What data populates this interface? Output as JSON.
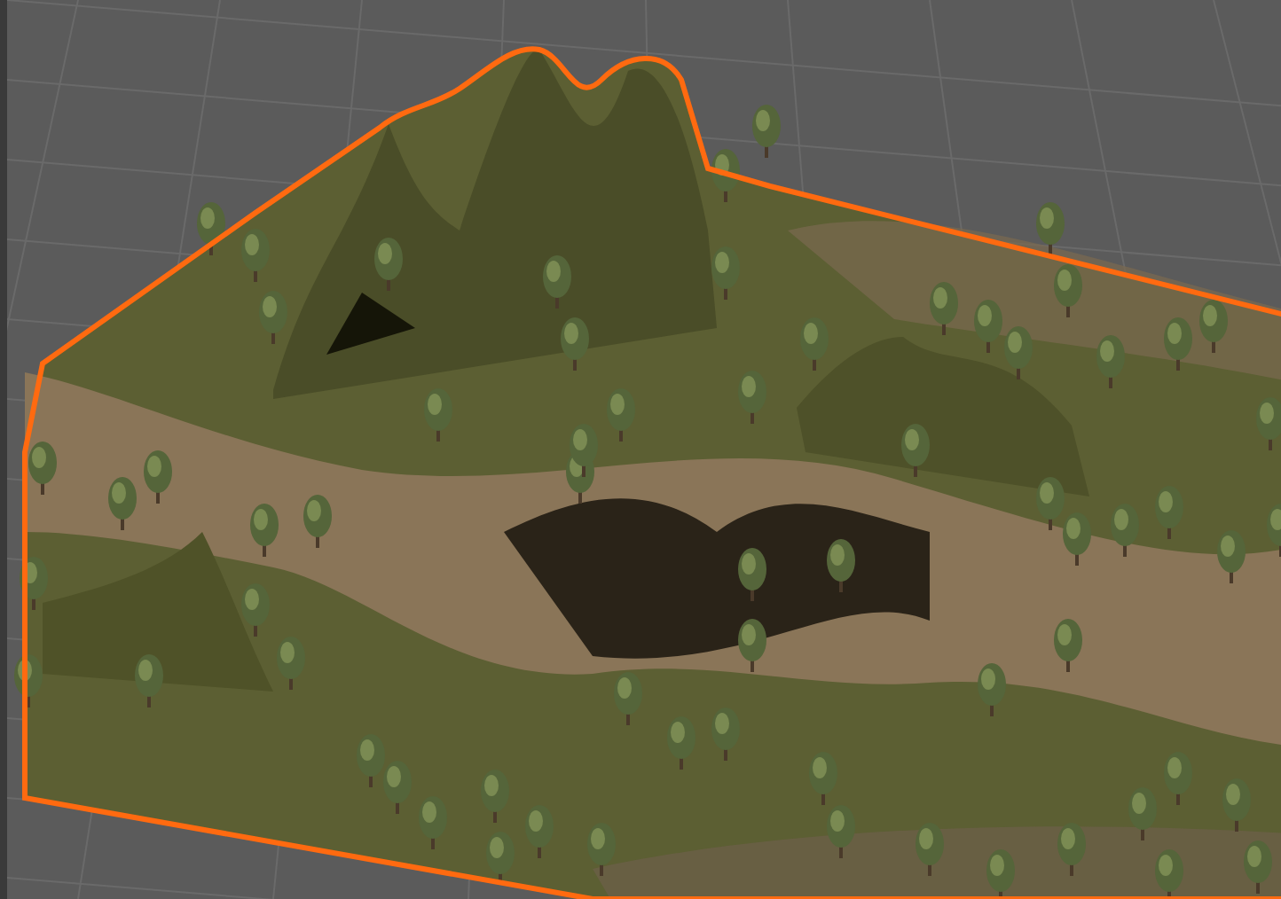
{
  "scene_view": {
    "terrain": {
      "selected": true
    }
  }
}
